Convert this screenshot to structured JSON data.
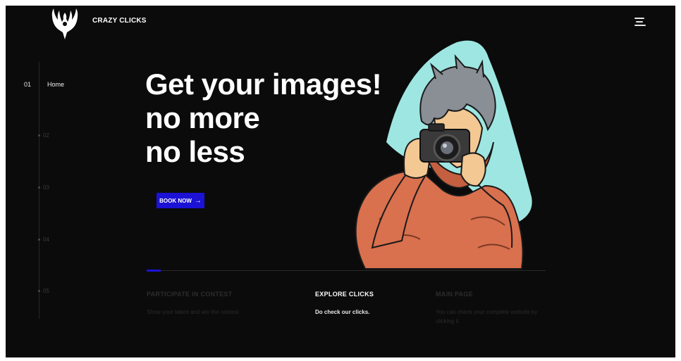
{
  "brand": {
    "name": "CRAZY CLICKS"
  },
  "nav": {
    "active_number": "01",
    "active_label": "Home",
    "items": [
      "02",
      "03",
      "04",
      "05"
    ]
  },
  "hero": {
    "headline": [
      "Get your images!",
      "no more",
      "no less"
    ],
    "cta_label": "BOOK NOW",
    "cta_icon": "arrow-right-icon"
  },
  "cards": [
    {
      "title": "PARTICIPATE IN CONTEST",
      "text": "Show your talent and win the contest",
      "state": "dim"
    },
    {
      "title": "EXPLORE CLICKS",
      "text": "Do check our clicks.",
      "state": "active"
    },
    {
      "title": "MAIN PAGE",
      "text": "You can check your complete website by clicking it",
      "state": "dim"
    }
  ],
  "colors": {
    "background": "#0b0b0b",
    "accent": "#1b12d6",
    "illustration_backdrop": "#9ee6e2",
    "hoodie": "#d9704e"
  }
}
